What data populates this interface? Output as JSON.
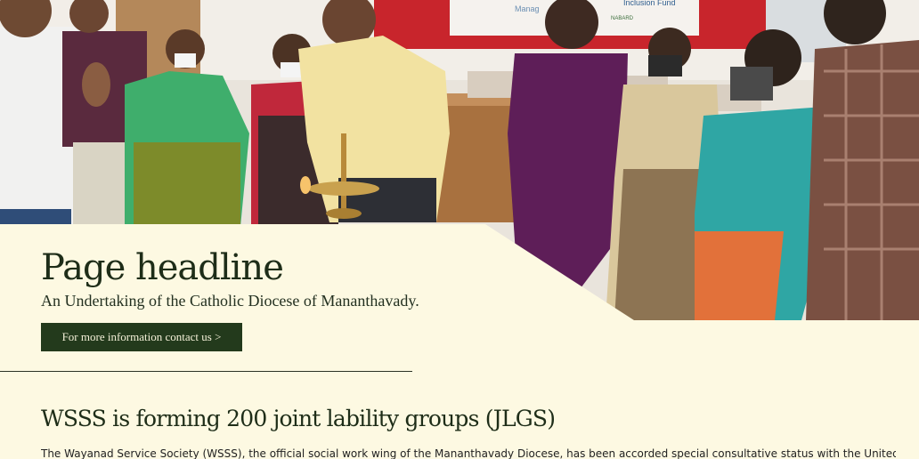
{
  "hero": {
    "headline": "Page headline",
    "subtitle": "An Undertaking of the Catholic Diocese of Mananthavady.",
    "cta_label": "For more information contact us >",
    "photo_alt": "",
    "banner_text_1": "Inclusion Fund",
    "banner_text_2": "Manag",
    "banner_text_3": "NABARD"
  },
  "section": {
    "title": "WSSS is forming 200 joint lability groups (JLGS)",
    "body": "The Wayanad Service Society (WSSS), the official social work wing of the Mananthavady Diocese, has been accorded special consultative status with the United"
  },
  "colors": {
    "background": "#fdf9e2",
    "accent_dark_green": "#233a1c",
    "heading_text": "#1e2d18"
  }
}
